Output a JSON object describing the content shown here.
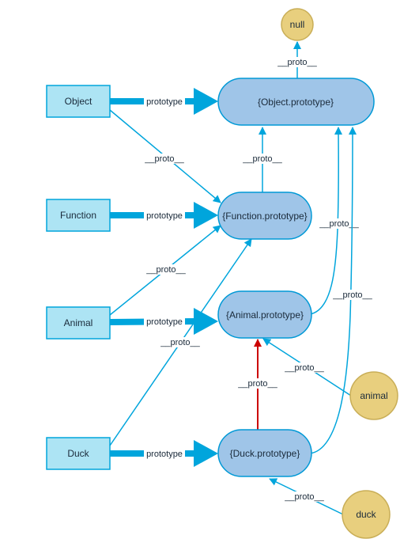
{
  "diagram": {
    "title": "",
    "colors": {
      "edge": "#00a5dc",
      "highlight_edge": "#cc0000",
      "constructor_fill": "#ade4f4",
      "constructor_stroke": "#00a5dc",
      "prototype_fill": "#9fc5e8",
      "prototype_stroke": "#0099d6",
      "instance_fill": "#e8cf7e",
      "instance_stroke": "#c9ae57"
    },
    "nodes": {
      "null": {
        "label": "null",
        "kind": "value"
      },
      "object": {
        "label": "Object",
        "kind": "constructor"
      },
      "function": {
        "label": "Function",
        "kind": "constructor"
      },
      "animal": {
        "label": "Animal",
        "kind": "constructor"
      },
      "duck": {
        "label": "Duck",
        "kind": "constructor"
      },
      "object_proto": {
        "label": "{Object.prototype}",
        "kind": "prototype"
      },
      "function_proto": {
        "label": "{Function.prototype}",
        "kind": "prototype"
      },
      "animal_proto": {
        "label": "{Animal.prototype}",
        "kind": "prototype"
      },
      "duck_proto": {
        "label": "{Duck.prototype}",
        "kind": "prototype"
      },
      "animal_inst": {
        "label": "animal",
        "kind": "instance"
      },
      "duck_inst": {
        "label": "duck",
        "kind": "instance"
      }
    },
    "edges": [
      {
        "from": "object",
        "to": "object_proto",
        "label": "prototype",
        "style": "thick"
      },
      {
        "from": "function",
        "to": "function_proto",
        "label": "prototype",
        "style": "thick"
      },
      {
        "from": "animal",
        "to": "animal_proto",
        "label": "prototype",
        "style": "thick"
      },
      {
        "from": "duck",
        "to": "duck_proto",
        "label": "prototype",
        "style": "thick"
      },
      {
        "from": "object_proto",
        "to": "null",
        "label": "__proto__",
        "style": "thin"
      },
      {
        "from": "object",
        "to": "function_proto",
        "label": "__proto__",
        "style": "thin"
      },
      {
        "from": "function_proto",
        "to": "object_proto",
        "label": "__proto__",
        "style": "thin"
      },
      {
        "from": "animal",
        "to": "function_proto",
        "label": "__proto__",
        "style": "thin"
      },
      {
        "from": "duck",
        "to": "function_proto",
        "label": "__proto__",
        "style": "thin"
      },
      {
        "from": "animal_proto",
        "to": "object_proto",
        "label": "__proto__",
        "style": "thin"
      },
      {
        "from": "duck_proto",
        "to": "object_proto",
        "label": "__proto__",
        "style": "thin"
      },
      {
        "from": "duck_proto",
        "to": "animal_proto",
        "label": "__proto__",
        "style": "highlight"
      },
      {
        "from": "animal_inst",
        "to": "animal_proto",
        "label": "__proto__",
        "style": "thin"
      },
      {
        "from": "duck_inst",
        "to": "duck_proto",
        "label": "__proto__",
        "style": "thin"
      }
    ]
  }
}
